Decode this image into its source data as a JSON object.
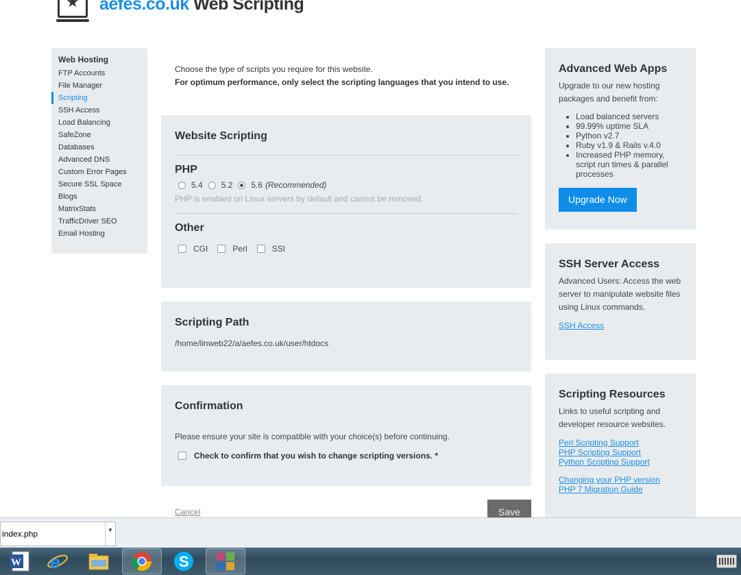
{
  "header": {
    "domain": "aefes.co.uk",
    "title": " Web Scripting"
  },
  "sidebar": {
    "heading": "Web Hosting",
    "items": [
      {
        "label": "FTP Accounts"
      },
      {
        "label": "File Manager"
      },
      {
        "label": "Scripting"
      },
      {
        "label": "SSH Access"
      },
      {
        "label": "Load Balancing"
      },
      {
        "label": "SafeZone"
      },
      {
        "label": "Databases"
      },
      {
        "label": "Advanced DNS"
      },
      {
        "label": "Custom Error Pages"
      },
      {
        "label": "Secure SSL Space"
      },
      {
        "label": "Blogs"
      },
      {
        "label": "MatrixStats"
      },
      {
        "label": "TrafficDriver SEO"
      },
      {
        "label": "Email Hosting"
      }
    ]
  },
  "intro": {
    "line1": "Choose the type of scripts you require for this website.",
    "line2": "For optimum performance, only select the scripting languages that you intend to use."
  },
  "scripting": {
    "title": "Website Scripting",
    "php_heading": "PHP",
    "php_options": [
      {
        "label": "5.4",
        "checked": false
      },
      {
        "label": "5.2",
        "checked": false
      },
      {
        "label": "5.6",
        "checked": true
      }
    ],
    "recommended": "(Recommended)",
    "php_note": "PHP is enabled on Linux servers by default and cannot be removed.",
    "other_heading": "Other",
    "other_options": [
      {
        "label": "CGI"
      },
      {
        "label": "Perl"
      },
      {
        "label": "SSI"
      }
    ]
  },
  "path": {
    "title": "Scripting Path",
    "value": "/home/linweb22/a/aefes.co.uk/user/htdocs"
  },
  "confirmation": {
    "title": "Confirmation",
    "text": "Please ensure your site is compatible with your choice(s) before continuing.",
    "checkbox_label": "Check to confirm that you wish to change scripting versions. *"
  },
  "actions": {
    "cancel": "Cancel",
    "save": "Save"
  },
  "advanced_apps": {
    "title": "Advanced Web Apps",
    "text": "Upgrade to our new hosting packages and benefit from:",
    "bullets": [
      "Load balanced servers",
      "99.99% uptime SLA",
      "Python v2.7",
      "Ruby v1.9 & Rails v.4.0",
      "Increased PHP memory, script run times & parallel processes"
    ],
    "button": "Upgrade Now"
  },
  "ssh": {
    "title": "SSH Server Access",
    "text": "Advanced Users: Access the web server to manipulate website files using Linux commands.",
    "link": "SSH Access"
  },
  "resources": {
    "title": "Scripting Resources",
    "text": "Links to useful scripting and developer resource websites.",
    "links_group1": [
      "Perl Scripting Support",
      "PHP Scripting Support",
      "Python Scripting Support"
    ],
    "links_group2": [
      "Changing your PHP version",
      "PHP 7 Migration Guide"
    ]
  },
  "download_bar": {
    "file": "index.php"
  },
  "taskbar": {
    "apps": [
      {
        "icon": "word-icon"
      },
      {
        "icon": "internet-explorer-icon"
      },
      {
        "icon": "file-explorer-icon"
      },
      {
        "icon": "chrome-icon"
      },
      {
        "icon": "skype-icon"
      },
      {
        "icon": "app-icon"
      }
    ]
  },
  "colors": {
    "accent": "#1c8ee2",
    "panel": "#e8ecef",
    "button": "#0f8ee9"
  }
}
